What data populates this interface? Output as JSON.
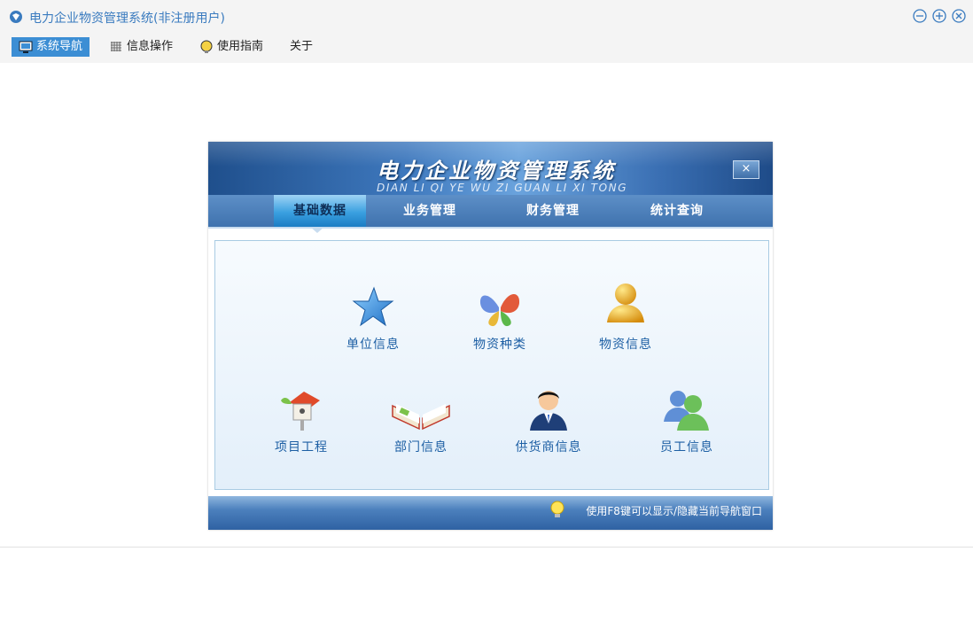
{
  "window": {
    "title": "电力企业物资管理系统(非注册用户)"
  },
  "menubar": {
    "items": [
      {
        "label": "系统导航",
        "icon": "monitor-icon",
        "active": true
      },
      {
        "label": "信息操作",
        "icon": "grid-icon",
        "active": false
      },
      {
        "label": "使用指南",
        "icon": "lightbulb-icon",
        "active": false
      },
      {
        "label": "关于",
        "icon": "",
        "active": false
      }
    ]
  },
  "navigator": {
    "title": "电力企业物资管理系统",
    "subtitle": "DIAN LI QI YE WU ZI GUAN LI XI TONG",
    "close_label": "×",
    "tabs": [
      {
        "label": "基础数据",
        "active": true
      },
      {
        "label": "业务管理",
        "active": false
      },
      {
        "label": "财务管理",
        "active": false
      },
      {
        "label": "统计查询",
        "active": false
      }
    ],
    "items": [
      {
        "label": "单位信息",
        "icon": "blue-star-icon"
      },
      {
        "label": "物资种类",
        "icon": "butterfly-icon"
      },
      {
        "label": "物资信息",
        "icon": "gold-user-icon"
      },
      {
        "label": "项目工程",
        "icon": "birdhouse-icon"
      },
      {
        "label": "部门信息",
        "icon": "open-book-icon"
      },
      {
        "label": "供货商信息",
        "icon": "businessman-icon"
      },
      {
        "label": "员工信息",
        "icon": "users-icon"
      }
    ],
    "footer_text": "使用F8键可以显示/隐藏当前导航窗口"
  },
  "colors": {
    "accent": "#3c8ed4",
    "title_text": "#3a7bbf",
    "item_label": "#1d5fa4"
  }
}
